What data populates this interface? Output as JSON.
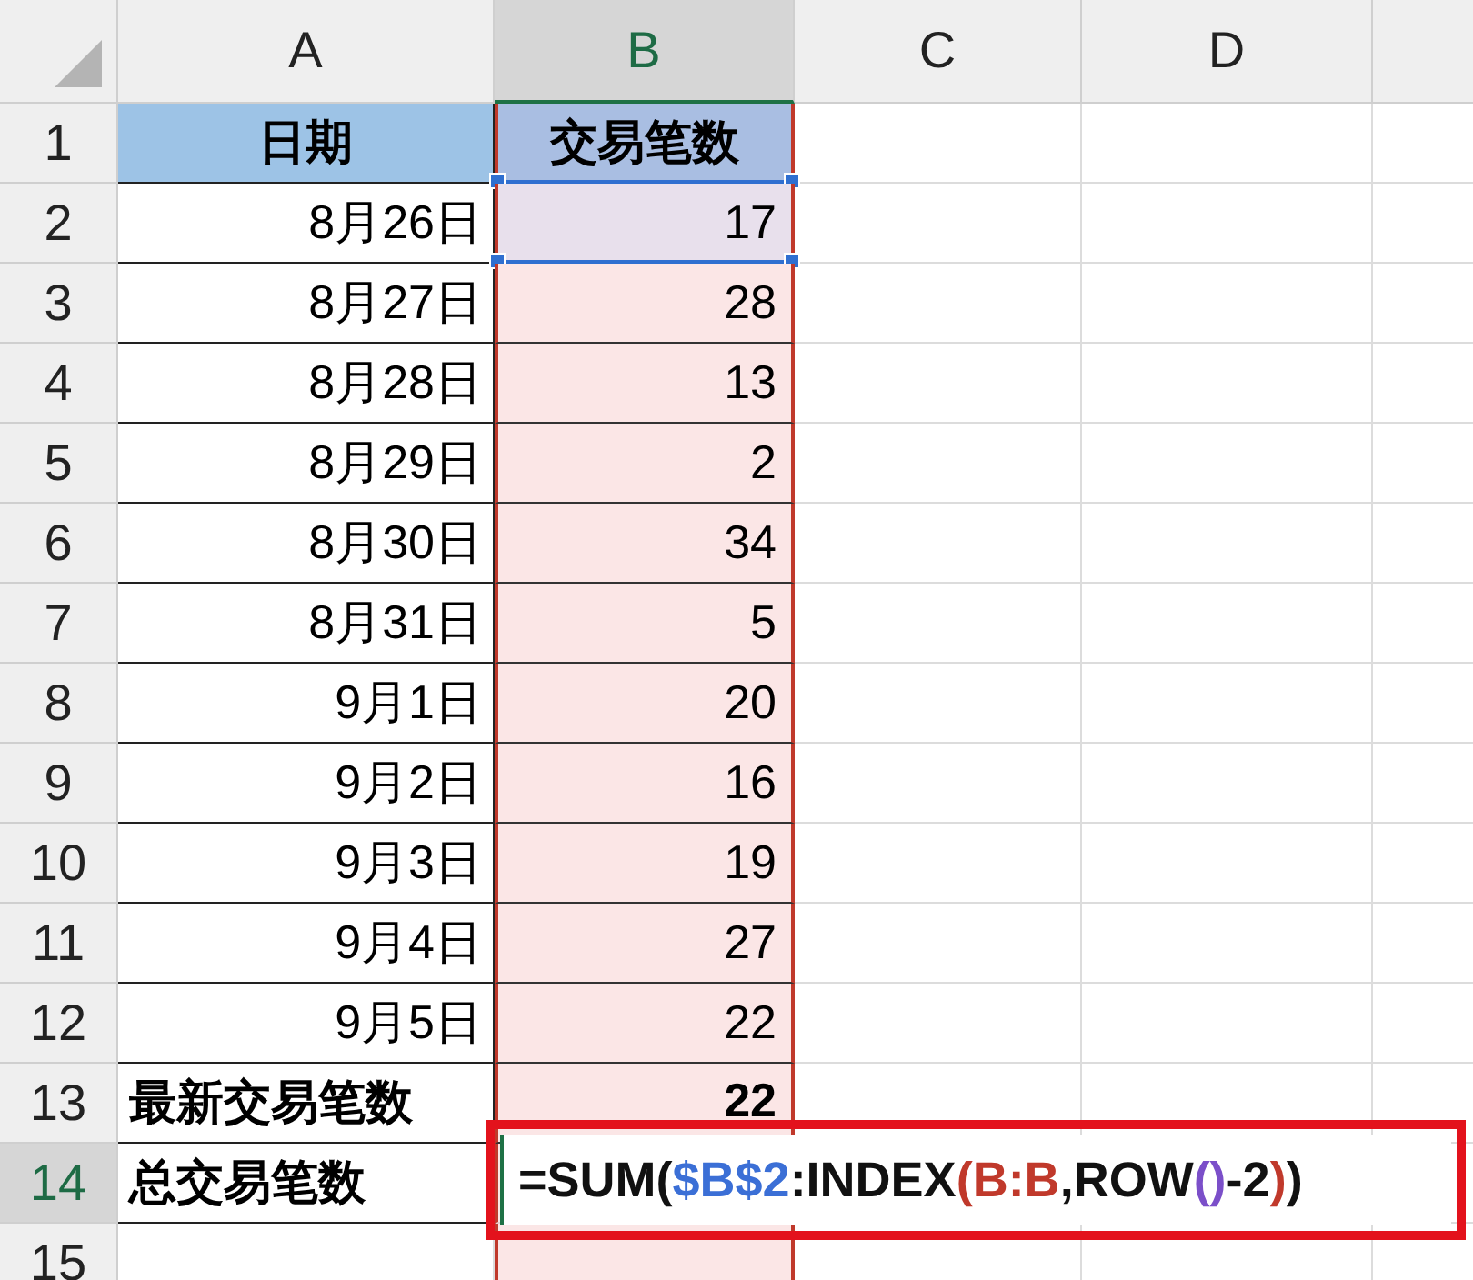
{
  "columns": [
    {
      "label": "A",
      "selected": false
    },
    {
      "label": "B",
      "selected": true
    },
    {
      "label": "C",
      "selected": false
    },
    {
      "label": "D",
      "selected": false
    }
  ],
  "rows": [
    {
      "label": "1",
      "selected": false,
      "kind": "header",
      "a": "日期",
      "b": "交易笔数"
    },
    {
      "label": "2",
      "selected": false,
      "kind": "data",
      "a": "8月26日",
      "b": "17"
    },
    {
      "label": "3",
      "selected": false,
      "kind": "data",
      "a": "8月27日",
      "b": "28"
    },
    {
      "label": "4",
      "selected": false,
      "kind": "data",
      "a": "8月28日",
      "b": "13"
    },
    {
      "label": "5",
      "selected": false,
      "kind": "data",
      "a": "8月29日",
      "b": "2"
    },
    {
      "label": "6",
      "selected": false,
      "kind": "data",
      "a": "8月30日",
      "b": "34"
    },
    {
      "label": "7",
      "selected": false,
      "kind": "data",
      "a": "8月31日",
      "b": "5"
    },
    {
      "label": "8",
      "selected": false,
      "kind": "data",
      "a": "9月1日",
      "b": "20"
    },
    {
      "label": "9",
      "selected": false,
      "kind": "data",
      "a": "9月2日",
      "b": "16"
    },
    {
      "label": "10",
      "selected": false,
      "kind": "data",
      "a": "9月3日",
      "b": "19"
    },
    {
      "label": "11",
      "selected": false,
      "kind": "data",
      "a": "9月4日",
      "b": "27"
    },
    {
      "label": "12",
      "selected": false,
      "kind": "data",
      "a": "9月5日",
      "b": "22"
    },
    {
      "label": "13",
      "selected": false,
      "kind": "summary",
      "a": "最新交易笔数",
      "b": "22"
    },
    {
      "label": "14",
      "selected": true,
      "kind": "summary",
      "a": "总交易笔数"
    },
    {
      "label": "15",
      "selected": false,
      "kind": "empty"
    }
  ],
  "formula_editor": {
    "parts": [
      {
        "text": "=SUM(",
        "color": "#111111"
      },
      {
        "text": "$B$2",
        "color": "#3b6fd6"
      },
      {
        "text": ":INDEX",
        "color": "#111111"
      },
      {
        "text": "(B:B",
        "color": "#c0392b"
      },
      {
        "text": ",ROW",
        "color": "#111111"
      },
      {
        "text": "()",
        "color": "#7b4fc9"
      },
      {
        "text": "-2",
        "color": "#111111"
      },
      {
        "text": ")",
        "color": "#c0392b"
      },
      {
        "text": ")",
        "color": "#111111"
      }
    ]
  }
}
